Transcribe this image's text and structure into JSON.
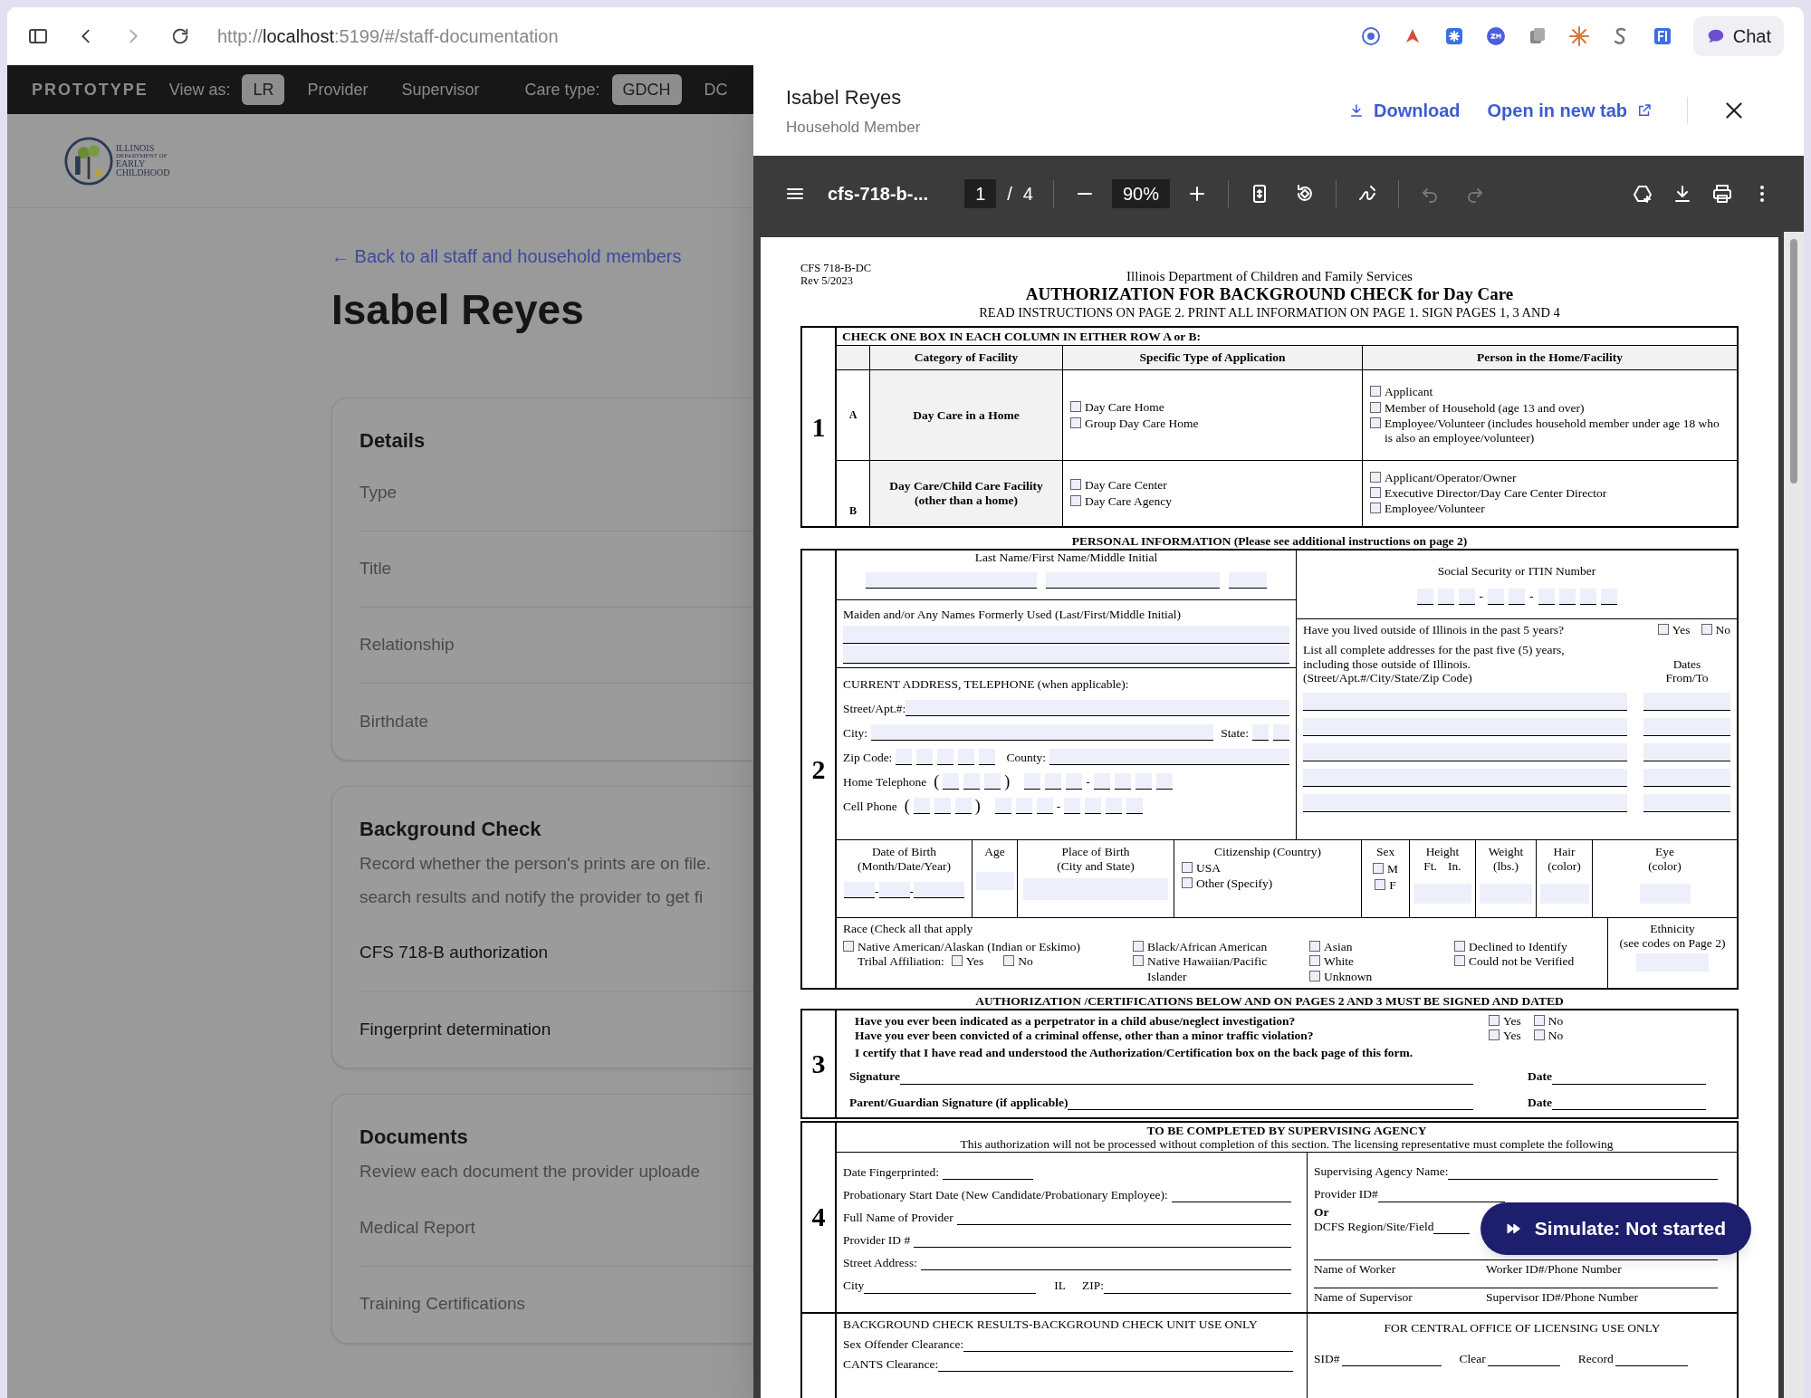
{
  "browser": {
    "url_parts": [
      {
        "text": "http://",
        "emphasis": false
      },
      {
        "text": "localhost",
        "emphasis": true
      },
      {
        "text": ":5199/#/staff-documentation",
        "emphasis": false
      }
    ],
    "chat_button": "Chat"
  },
  "top_nav": {
    "brand": "PROTOTYPE",
    "view_as_label": "View as:",
    "view_options": [
      {
        "label": "LR",
        "selected": true
      },
      {
        "label": "Provider",
        "selected": false
      },
      {
        "label": "Supervisor",
        "selected": false
      }
    ],
    "care_type_label": "Care type:",
    "care_types": [
      {
        "label": "GDCH",
        "selected": true
      },
      {
        "label": "DC",
        "selected": false
      }
    ]
  },
  "logo_lines": [
    "ILLINOIS",
    "DEPARTMENT OF",
    "EARLY",
    "CHILDHOOD"
  ],
  "page": {
    "back_link": "← Back to all staff and household members",
    "title": "Isabel Reyes",
    "cards": [
      {
        "title": "Details",
        "rows": [
          {
            "label": "Type",
            "emphasis": false
          },
          {
            "label": "Title",
            "emphasis": false
          },
          {
            "label": "Relationship",
            "emphasis": false
          },
          {
            "label": "Birthdate",
            "emphasis": false
          }
        ]
      },
      {
        "title": "Background Check",
        "description_lines": [
          "Record whether the person's prints are on file.",
          "search results and notify the provider to get fi"
        ],
        "rows": [
          {
            "label": "CFS 718-B authorization",
            "emphasis": true
          },
          {
            "label": "Fingerprint determination",
            "emphasis": true
          }
        ]
      },
      {
        "title": "Documents",
        "description_lines": [
          "Review each document the provider uploade"
        ],
        "rows": [
          {
            "label": "Medical Report",
            "emphasis": false
          },
          {
            "label": "Training Certifications",
            "emphasis": false
          }
        ]
      }
    ]
  },
  "drawer": {
    "name": "Isabel Reyes",
    "subtitle": "Household Member",
    "download": "Download",
    "open_new_tab": "Open in new tab",
    "pdf_toolbar": {
      "filename": "cfs-718-b-...",
      "page": "1",
      "page_separator": "/",
      "page_total": "4",
      "zoom": "90%"
    }
  },
  "simulate_button": "Simulate: Not started",
  "form": {
    "code": "CFS 718-B-DC",
    "rev": "Rev 5/2023",
    "agency": "Illinois Department of Children and Family Services",
    "title": "AUTHORIZATION FOR BACKGROUND CHECK for Day Care",
    "instructions": "READ INSTRUCTIONS ON PAGE 2. PRINT ALL INFORMATION ON PAGE 1.  SIGN PAGES 1, 3 AND 4",
    "section1": {
      "number": "1",
      "heading": "CHECK ONE BOX IN EACH COLUMN IN EITHER ROW A or B:",
      "columns": [
        "Category of Facility",
        "Specific Type of Application",
        "Person in the Home/Facility"
      ],
      "rows": [
        {
          "letter": "A",
          "category": "Day Care in a Home",
          "types": [
            {
              "label": "Day Care Home",
              "checked": false
            },
            {
              "label": "Group Day Care Home",
              "checked": false
            }
          ],
          "persons": [
            {
              "label": "Applicant",
              "checked": false
            },
            {
              "label": "Member of Household (age 13 and over)",
              "checked": false
            },
            {
              "label": "Employee/Volunteer (includes household member under age 18 who is also an employee/volunteer)",
              "checked": false
            }
          ]
        },
        {
          "letter": "B",
          "category": "Day Care/Child Care Facility (other than a home)",
          "types": [
            {
              "label": "Day Care Center",
              "checked": false
            },
            {
              "label": "Day Care Agency",
              "checked": false
            }
          ],
          "persons": [
            {
              "label": "Applicant/Operator/Owner",
              "checked": false
            },
            {
              "label": "Executive Director/Day Care Center Director",
              "checked": false
            },
            {
              "label": "Employee/Volunteer",
              "checked": false
            }
          ]
        }
      ]
    },
    "section2": {
      "number": "2",
      "heading": "PERSONAL INFORMATION (Please see additional instructions on page 2)",
      "name_label": "Last Name/First Name/Middle Initial",
      "maiden_label": "Maiden and/or Any Names Formerly Used (Last/First/Middle Initial)",
      "address_heading": "CURRENT ADDRESS, TELEPHONE (when applicable):",
      "street_label": "Street/Apt.#:",
      "city_label": "City:",
      "state_label": "State:",
      "zip_label": "Zip Code:",
      "county_label": "County:",
      "phones": [
        {
          "label": "Home Telephone",
          "open": "(",
          "close": ")",
          "dash": "-"
        },
        {
          "label": "Cell Phone",
          "open": "(",
          "close": ")",
          "dash": "-"
        }
      ],
      "ssn_label": "Social Security or ITIN Number",
      "ssn_dashes": [
        "-",
        "-"
      ],
      "lived_outside": {
        "question": "Have you lived outside of Illinois in the past 5 years?",
        "options": [
          {
            "label": "Yes",
            "checked": false
          },
          {
            "label": "No",
            "checked": false
          }
        ]
      },
      "addresses_label": "List all complete addresses for the past five (5) years,\nincluding those outside of Illinois.\n(Street/Apt.#/City/State/Zip Code)",
      "dates_label": "Dates\nFrom/To",
      "dob": {
        "label": "Date of Birth\n(Month/Date/Year)",
        "dashes": [
          "-",
          "-"
        ]
      },
      "age_label": "Age",
      "pob_label": "Place of Birth\n(City and State)",
      "citizenship": {
        "label": "Citizenship (Country)",
        "options": [
          {
            "label": "USA",
            "checked": false
          },
          {
            "label": "Other (Specify)",
            "checked": false
          }
        ]
      },
      "sex": {
        "label": "Sex",
        "options": [
          {
            "label": "M",
            "checked": false
          },
          {
            "label": "F",
            "checked": false
          }
        ]
      },
      "height": {
        "label": "Height",
        "units": [
          "Ft.",
          "In."
        ]
      },
      "weight_label": "Weight\n(lbs.)",
      "hair_label": "Hair\n(color)",
      "eye_label": "Eye\n(color)",
      "race": {
        "label": "Race (Check all that apply",
        "groups": [
          [
            {
              "label": "Native American/Alaskan (Indian or Eskimo)",
              "checked": false
            }
          ],
          [
            {
              "label": "Black/African  American",
              "checked": false
            },
            {
              "label": "Native Hawaiian/Pacific\nIslander",
              "checked": false
            }
          ],
          [
            {
              "label": "Asian",
              "checked": false
            },
            {
              "label": "White",
              "checked": false
            },
            {
              "label": "Unknown",
              "checked": false
            }
          ],
          [
            {
              "label": "Declined to Identify",
              "checked": false
            },
            {
              "label": "Could not be Verified",
              "checked": false
            }
          ]
        ],
        "tribal": {
          "label": "Tribal Affiliation:",
          "options": [
            {
              "label": "Yes",
              "checked": false
            },
            {
              "label": "No",
              "checked": false
            }
          ]
        }
      },
      "ethnicity_label": "Ethnicity\n(see codes on Page 2)"
    },
    "section3": {
      "number": "3",
      "heading": "AUTHORIZATION /CERTIFICATIONS BELOW AND ON PAGES 2 AND 3 MUST BE SIGNED AND DATED",
      "questions": [
        {
          "text": "Have you ever been indicated as a perpetrator in a child abuse/neglect investigation?",
          "options": [
            {
              "label": "Yes",
              "checked": false
            },
            {
              "label": "No",
              "checked": false
            }
          ]
        },
        {
          "text": "Have you ever been convicted of a criminal offense, other than a minor traffic violation?",
          "options": [
            {
              "label": "Yes",
              "checked": false
            },
            {
              "label": "No",
              "checked": false
            }
          ]
        }
      ],
      "certify": "I certify that I have read and understood the Authorization/Certification box on the back page of this form.",
      "signatures": [
        {
          "label": "Signature",
          "date_label": "Date"
        },
        {
          "label": "Parent/Guardian Signature (if applicable)",
          "date_label": "Date"
        }
      ]
    },
    "section4": {
      "number": "4",
      "heading": "TO BE COMPLETED BY SUPERVISING AGENCY",
      "note": "This authorization will not be processed without completion of this section. The licensing representative  must complete the following",
      "left_fields": [
        "Date Fingerprinted:",
        "Probationary Start Date (New Candidate/Probationary Employee):",
        "Full Name of Provider",
        "Provider ID #",
        "Street Address:"
      ],
      "city_row": {
        "city": "City",
        "state": "IL",
        "zip": "ZIP:"
      },
      "agency_label": "Supervising Agency Name:",
      "provider_id_label": "Provider ID#",
      "or_label": "Or",
      "region_label": "DCFS Region/Site/Field",
      "worker": [
        "Name of Worker",
        "Worker ID#/Phone Number"
      ],
      "supervisor": [
        "Name of Supervisor",
        "Supervisor ID#/Phone Number"
      ]
    },
    "section5": {
      "left_heading": "BACKGROUND CHECK RESULTS-BACKGROUND CHECK UNIT USE ONLY",
      "left_fields": [
        "Sex Offender Clearance:",
        "CANTS Clearance:"
      ],
      "right_heading": "FOR CENTRAL OFFICE OF LICENSING USE ONLY",
      "right_fields": [
        "SID#",
        "Clear",
        "Record"
      ]
    }
  }
}
